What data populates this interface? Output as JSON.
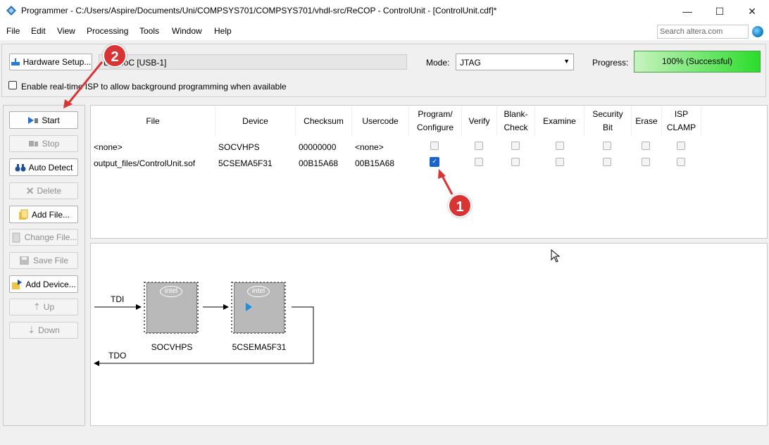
{
  "window": {
    "title": "Programmer - C:/Users/Aspire/Documents/Uni/COMPSYS701/COMPSYS701/vhdl-src/ReCOP - ControlUnit - [ControlUnit.cdf]*",
    "minimize": "—",
    "maximize": "☐",
    "close": "✕"
  },
  "menu": [
    "File",
    "Edit",
    "View",
    "Processing",
    "Tools",
    "Window",
    "Help"
  ],
  "search": {
    "placeholder": "Search altera.com"
  },
  "toolbar": {
    "hardware_setup": "Hardware Setup...",
    "hardware_value": "DE-SoC [USB-1]",
    "mode_label": "Mode:",
    "mode_value": "JTAG",
    "progress_label": "Progress:",
    "progress_text": "100% (Successful)",
    "progress_percent": 100,
    "isp_label": "Enable real-time ISP to allow background programming when available"
  },
  "sidebar": {
    "start": "Start",
    "stop": "Stop",
    "auto_detect": "Auto Detect",
    "delete": "Delete",
    "add_file": "Add File...",
    "change_file": "Change File...",
    "save_file": "Save File",
    "add_device": "Add Device...",
    "up": "Up",
    "down": "Down"
  },
  "table": {
    "headers": {
      "file": "File",
      "device": "Device",
      "checksum": "Checksum",
      "usercode": "Usercode",
      "program1": "Program/",
      "program2": "Configure",
      "verify": "Verify",
      "blank1": "Blank-",
      "blank2": "Check",
      "examine": "Examine",
      "security1": "Security",
      "security2": "Bit",
      "erase": "Erase",
      "isp1": "ISP",
      "isp2": "CLAMP"
    },
    "rows": [
      {
        "file": "<none>",
        "device": "SOCVHPS",
        "checksum": "00000000",
        "usercode": "<none>",
        "program": false
      },
      {
        "file": "output_files/ControlUnit.sof",
        "device": "5CSEMA5F31",
        "checksum": "00B15A68",
        "usercode": "00B15A68",
        "program": true
      }
    ]
  },
  "chain": {
    "tdi": "TDI",
    "tdo": "TDO",
    "device1": "SOCVHPS",
    "device2": "5CSEMA5F31",
    "intel": "intel"
  },
  "annotations": {
    "one": "1",
    "two": "2"
  },
  "colors": {
    "accent": "#1a63c8",
    "badge": "#d93434",
    "progress": "#2bdc2b"
  }
}
